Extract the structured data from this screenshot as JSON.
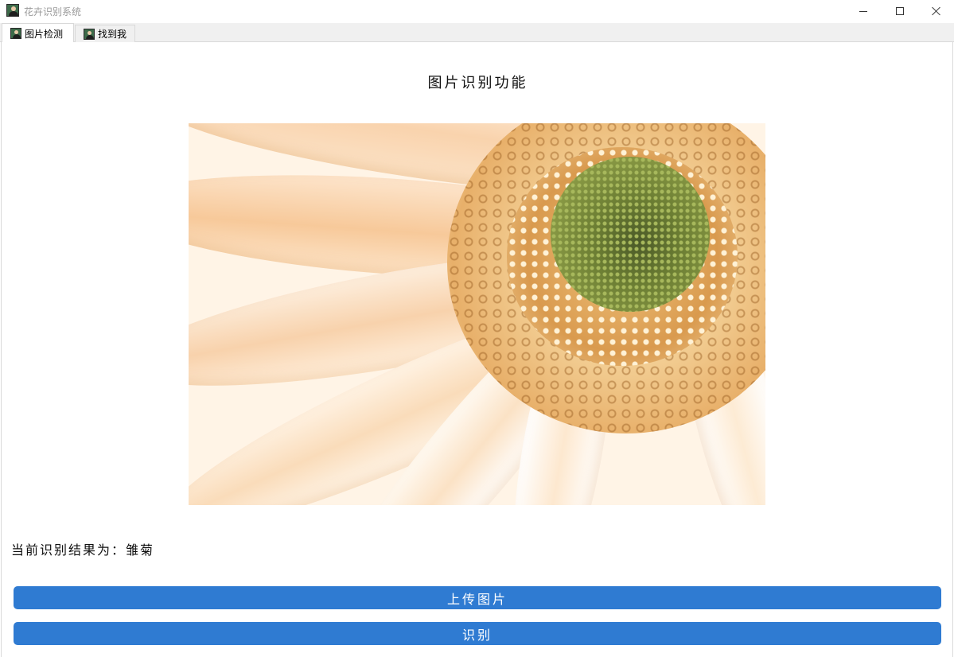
{
  "window": {
    "title": "花卉识别系统",
    "icon": "user-photo-icon"
  },
  "tabs": [
    {
      "label": "图片检测",
      "icon": "user-photo-icon",
      "active": true
    },
    {
      "label": "找到我",
      "icon": "user-photo-icon",
      "active": false
    }
  ],
  "main": {
    "title": "图片识别功能",
    "result_text": "当前识别结果为：雏菊",
    "upload_button_label": "上传图片",
    "recognize_button_label": "识别"
  },
  "colors": {
    "button_background": "#2f7bd2",
    "button_text": "#ffffff",
    "tab_bar_background": "#f0f0f0"
  }
}
